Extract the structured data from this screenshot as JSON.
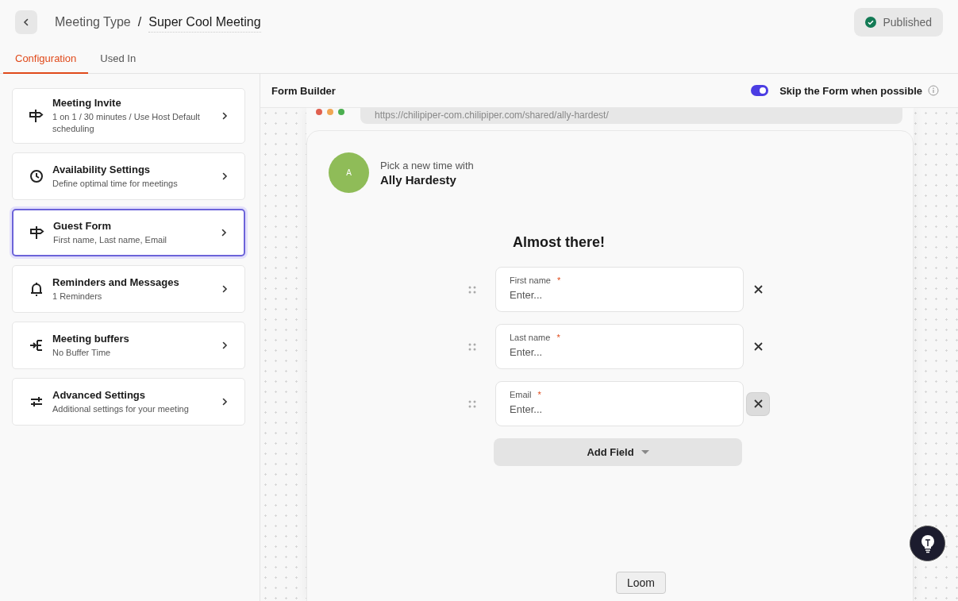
{
  "header": {
    "breadcrumb": "Meeting Type",
    "separator": "/",
    "title": "Super Cool Meeting",
    "status": "Published"
  },
  "tabs": [
    {
      "label": "Configuration",
      "selected": true
    },
    {
      "label": "Used In",
      "selected": false
    }
  ],
  "sidebar": {
    "items": [
      {
        "title": "Meeting Invite",
        "subtitle": "1 on 1 / 30 minutes / Use Host Default scheduling",
        "selected": false
      },
      {
        "title": "Availability Settings",
        "subtitle": "Define optimal time for meetings",
        "selected": false
      },
      {
        "title": "Guest Form",
        "subtitle": "First name, Last name, Email",
        "selected": true
      },
      {
        "title": "Reminders and Messages",
        "subtitle": "1 Reminders",
        "selected": false
      },
      {
        "title": "Meeting buffers",
        "subtitle": "No Buffer Time",
        "selected": false
      },
      {
        "title": "Advanced Settings",
        "subtitle": "Additional settings for your meeting",
        "selected": false
      }
    ]
  },
  "form_builder": {
    "title": "Form Builder",
    "skip_toggle": {
      "label": "Skip the Form when possible",
      "on": true
    },
    "preview": {
      "url": "https://chilipiper-com.chilipiper.com/shared/ally-hardest/",
      "avatar": "A",
      "intro": "Pick a new time with",
      "host": "Ally Hardesty",
      "heading": "Almost there!",
      "fields": [
        {
          "label": "First name",
          "required_mark": "*",
          "placeholder": "Enter...",
          "remove_hovered": false
        },
        {
          "label": "Last name",
          "required_mark": "*",
          "placeholder": "Enter...",
          "remove_hovered": false
        },
        {
          "label": "Email",
          "required_mark": "*",
          "placeholder": "Enter...",
          "remove_hovered": true
        }
      ],
      "add_button": "Add Field"
    }
  },
  "tooltip": "Loom"
}
